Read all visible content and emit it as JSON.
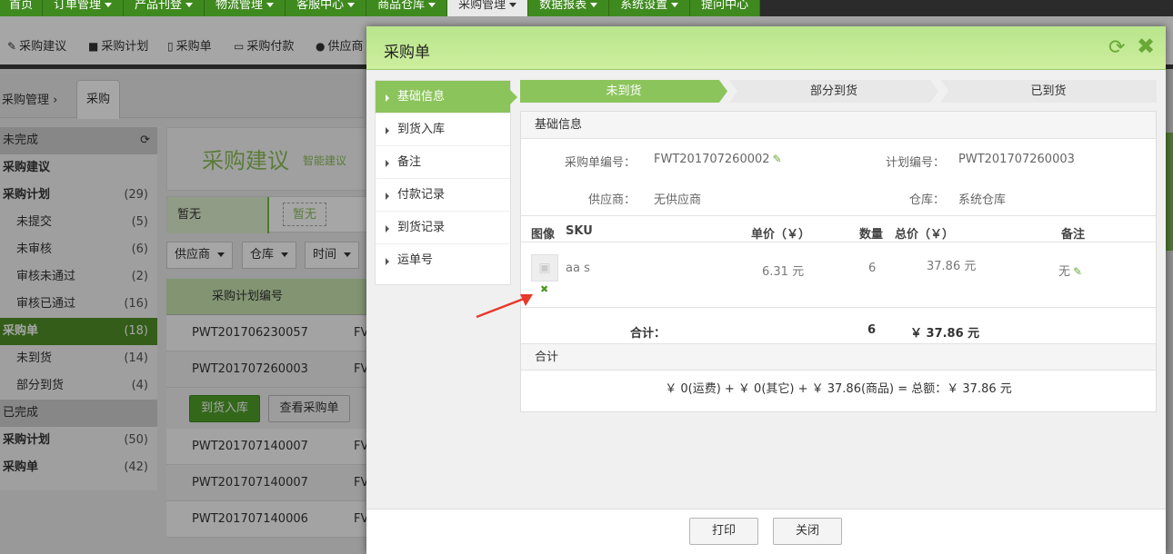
{
  "topnav": [
    {
      "label": "首页",
      "caret": false,
      "active": false
    },
    {
      "label": "订单管理",
      "caret": true,
      "active": false
    },
    {
      "label": "产品刊登",
      "caret": true,
      "active": false
    },
    {
      "label": "物流管理",
      "caret": true,
      "active": false
    },
    {
      "label": "客服中心",
      "caret": true,
      "active": false
    },
    {
      "label": "商品仓库",
      "caret": true,
      "active": false
    },
    {
      "label": "采购管理",
      "caret": true,
      "active": true
    },
    {
      "label": "数据报表",
      "caret": true,
      "active": false
    },
    {
      "label": "系统设置",
      "caret": true,
      "active": false
    },
    {
      "label": "提问中心",
      "caret": false,
      "active": false
    }
  ],
  "toolbar": {
    "items": [
      {
        "icon": "wand-icon",
        "label": "采购建议"
      },
      {
        "icon": "book-icon",
        "label": "采购计划"
      },
      {
        "icon": "file-icon",
        "label": "采购单"
      },
      {
        "icon": "card-icon",
        "label": "采购付款"
      },
      {
        "icon": "users-icon",
        "label": "供应商"
      }
    ]
  },
  "breadcrumb": {
    "root": "采购管理",
    "tab": "采购"
  },
  "sidebar": {
    "incomplete_header": "未完成",
    "completed_header": "已完成",
    "incomplete": [
      {
        "label": "采购建议",
        "count": "",
        "bold": true,
        "sub": false,
        "active": false
      },
      {
        "label": "采购计划",
        "count": "(29)",
        "bold": true,
        "sub": false,
        "active": false
      },
      {
        "label": "未提交",
        "count": "(5)",
        "bold": false,
        "sub": true,
        "active": false
      },
      {
        "label": "未审核",
        "count": "(6)",
        "bold": false,
        "sub": true,
        "active": false
      },
      {
        "label": "审核未通过",
        "count": "(2)",
        "bold": false,
        "sub": true,
        "active": false
      },
      {
        "label": "审核已通过",
        "count": "(16)",
        "bold": false,
        "sub": true,
        "active": false
      },
      {
        "label": "采购单",
        "count": "(18)",
        "bold": true,
        "sub": false,
        "active": true
      },
      {
        "label": "未到货",
        "count": "(14)",
        "bold": false,
        "sub": true,
        "active": false
      },
      {
        "label": "部分到货",
        "count": "(4)",
        "bold": false,
        "sub": true,
        "active": false
      }
    ],
    "completed": [
      {
        "label": "采购计划",
        "count": "(50)",
        "bold": true,
        "sub": false,
        "active": false
      },
      {
        "label": "采购单",
        "count": "(42)",
        "bold": true,
        "sub": false,
        "active": false
      }
    ]
  },
  "main": {
    "banner_title": "采购建议",
    "banner_sub": "智能建议",
    "tab_active": "暂无",
    "tab_other": "暂无",
    "filters": [
      "供应商",
      "仓库",
      "时间"
    ],
    "column_header": "采购计划编号",
    "rows": [
      "PWT201706230057",
      "PWT201707260003",
      "PWT201707140007",
      "PWT201707140007",
      "PWT201707140006"
    ],
    "row_suffix": "FV",
    "action_green": "到货入库",
    "action_grey": "查看采购单"
  },
  "modal": {
    "title": "采购单",
    "menu": [
      "基础信息",
      "到货入库",
      "备注",
      "付款记录",
      "到货记录",
      "运单号"
    ],
    "steps": [
      "未到货",
      "部分到货",
      "已到货"
    ],
    "section_basic": "基础信息",
    "order_no_label": "采购单编号：",
    "order_no": "FWT201707260002",
    "plan_no_label": "计划编号：",
    "plan_no": "PWT201707260003",
    "supplier_label": "供应商：",
    "supplier": "无供应商",
    "warehouse_label": "仓库：",
    "warehouse": "系统仓库",
    "table_headers": {
      "image": "图像",
      "sku": "SKU",
      "unit_price": "单价（￥）",
      "qty": "数量",
      "total": "总价（￥）",
      "remark": "备注"
    },
    "item": {
      "sku": "aa   s",
      "unit_price": "6.31 元",
      "qty": "6",
      "total": "37.86 元",
      "remark": "无"
    },
    "sum_label": "合计：",
    "sum_qty": "6",
    "sum_total": "￥ 37.86 元",
    "section_total": "合计",
    "total_line": "￥ 0(运费) + ￥ 0(其它) + ￥ 37.86(商品) = 总额：￥ 37.86 元",
    "print_label": "打印",
    "close_label": "关闭"
  },
  "colors": {
    "brand_green": "#3f8a1e",
    "accent": "#8cc45c",
    "annotation": "#e8392b"
  }
}
